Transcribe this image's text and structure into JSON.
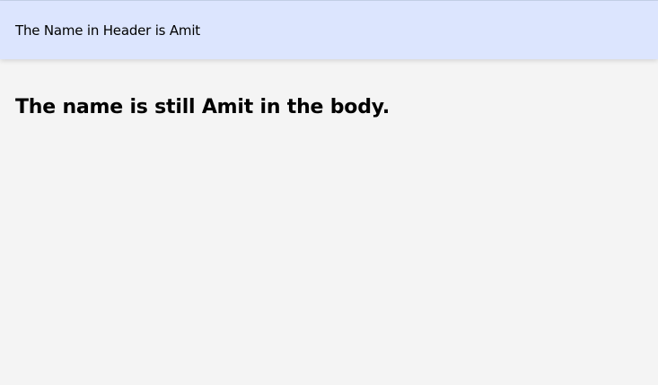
{
  "header": {
    "text": "The Name in Header is Amit"
  },
  "main": {
    "heading": "The name is still Amit in the body."
  }
}
